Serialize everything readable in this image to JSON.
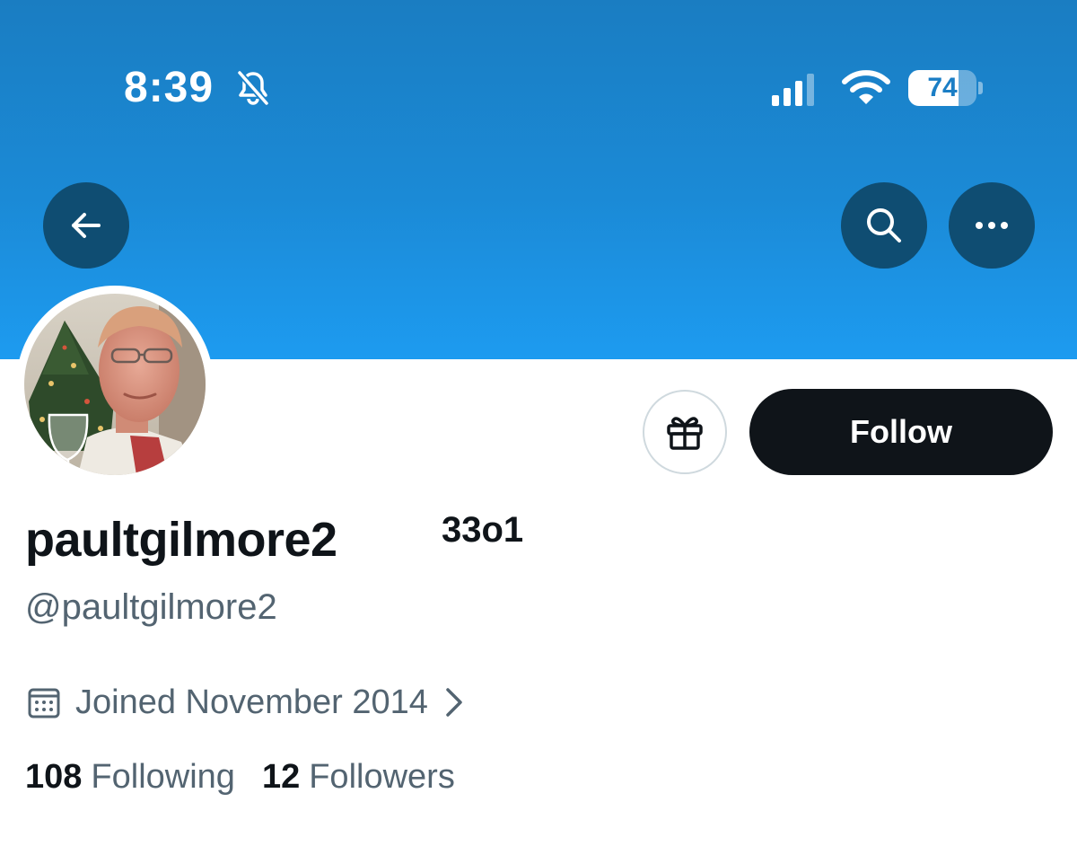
{
  "status_bar": {
    "time": "8:39",
    "battery_level": "74",
    "battery_fraction": 0.74
  },
  "header": {
    "banner_color": "#1d9bf0",
    "back_icon": "arrow-left-icon",
    "search_icon": "search-icon",
    "more_icon": "more-horizontal-icon"
  },
  "profile": {
    "display_name": "paultgilmore2",
    "name_suffix": "33o1",
    "handle": "@paultgilmore2",
    "joined": "Joined November 2014",
    "following_count": "108",
    "following_label": "Following",
    "followers_count": "12",
    "followers_label": "Followers"
  },
  "actions": {
    "follow_label": "Follow",
    "gift_icon": "gift-icon"
  },
  "colors": {
    "primary_text": "#0f1419",
    "secondary_text": "#536471",
    "follow_button_bg": "#0f1419",
    "icon_button_bg": "#0f4d72"
  }
}
